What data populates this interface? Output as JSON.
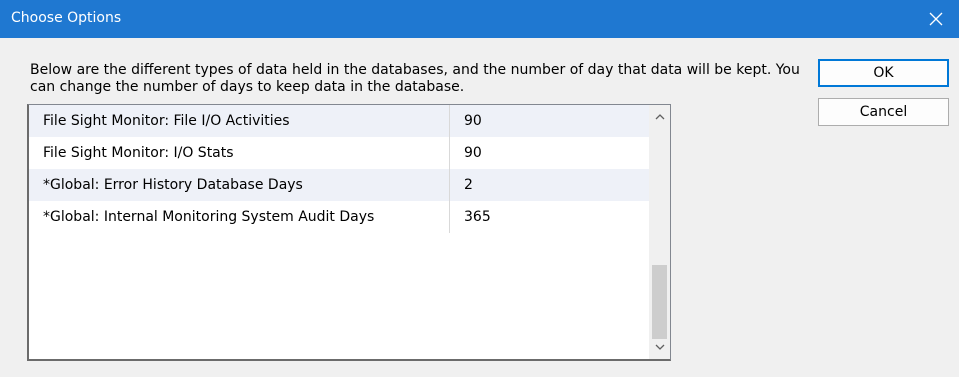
{
  "window": {
    "title": "Choose Options"
  },
  "description": "Below are the different types of data held in the databases, and the number of day that data will be kept.  You can change the number of days to keep data in the database.",
  "buttons": {
    "ok": "OK",
    "cancel": "Cancel"
  },
  "table": {
    "rows": [
      {
        "name": "File Sight Monitor: File I/O Activities",
        "days": "90"
      },
      {
        "name": "File Sight Monitor: I/O Stats",
        "days": "90"
      },
      {
        "name": "*Global: Error History Database Days",
        "days": "2"
      },
      {
        "name": "*Global: Internal Monitoring System Audit Days",
        "days": "365"
      }
    ]
  },
  "icons": {
    "close": "close-icon",
    "scroll_up": "chevron-up-icon",
    "scroll_down": "chevron-down-icon"
  },
  "colors": {
    "titlebar": "#1f78d1",
    "alt_row": "#eef1f8",
    "ok_border": "#0078d7"
  }
}
